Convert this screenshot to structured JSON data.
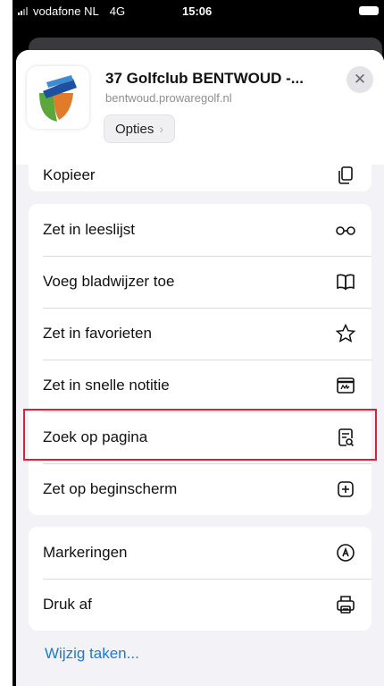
{
  "status_bar": {
    "carrier": "vodafone NL",
    "network": "4G",
    "time": "15:06"
  },
  "share_header": {
    "title": "37 Golfclub BENTWOUD -...",
    "url": "bentwoud.prowaregolf.nl",
    "options_label": "Opties",
    "close_icon": "close-icon"
  },
  "actions": {
    "copy": {
      "label": "Kopieer",
      "icon": "copy-icon"
    },
    "menu": [
      {
        "label": "Zet in leeslijst",
        "icon": "glasses-icon"
      },
      {
        "label": "Voeg bladwijzer toe",
        "icon": "book-icon"
      },
      {
        "label": "Zet in favorieten",
        "icon": "star-icon"
      },
      {
        "label": "Zet in snelle notitie",
        "icon": "quick-note-icon"
      },
      {
        "label": "Zoek op pagina",
        "icon": "find-on-page-icon"
      },
      {
        "label": "Zet op beginscherm",
        "icon": "add-square-icon"
      }
    ],
    "more": [
      {
        "label": "Markeringen",
        "icon": "markup-icon"
      },
      {
        "label": "Druk af",
        "icon": "print-icon"
      }
    ],
    "edit_label": "Wijzig taken..."
  },
  "colors": {
    "highlight": "#d6223b",
    "link": "#1a7ad6"
  }
}
